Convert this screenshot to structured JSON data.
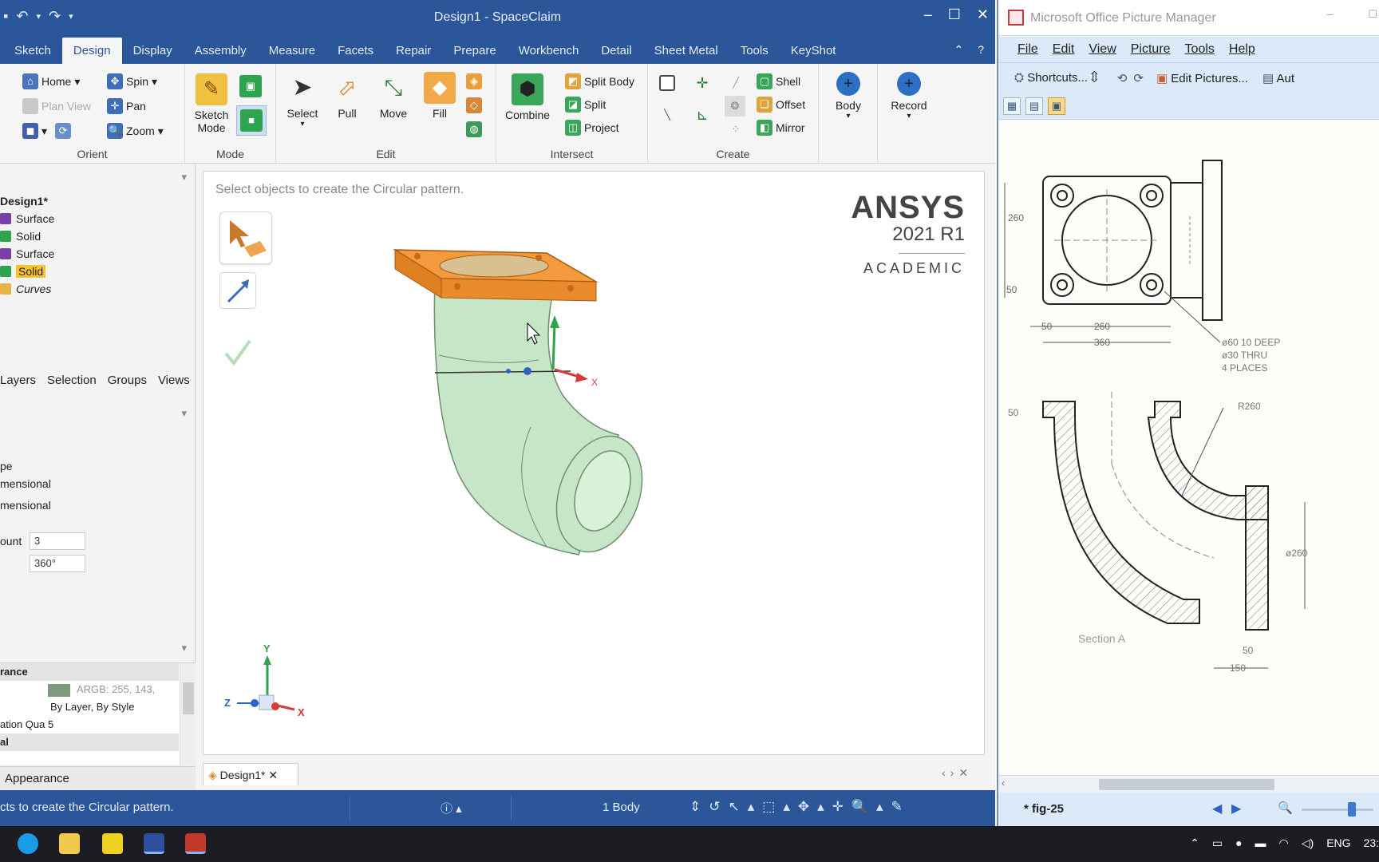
{
  "spaceclaim": {
    "title": "Design1 - SpaceClaim",
    "tabs": [
      "Sketch",
      "Design",
      "Display",
      "Assembly",
      "Measure",
      "Facets",
      "Repair",
      "Prepare",
      "Workbench",
      "Detail",
      "Sheet Metal",
      "Tools",
      "KeyShot"
    ],
    "ribbon": {
      "orient": {
        "label": "Orient",
        "home": "Home",
        "spin": "Spin",
        "plan_view": "Plan View",
        "pan": "Pan",
        "zoom": "Zoom"
      },
      "mode": {
        "label": "Mode",
        "sketch_mode": "Sketch Mode"
      },
      "edit": {
        "label": "Edit",
        "select": "Select",
        "pull": "Pull",
        "move": "Move",
        "fill": "Fill"
      },
      "intersect": {
        "label": "Intersect",
        "combine": "Combine",
        "split_body": "Split Body",
        "split": "Split",
        "project": "Project"
      },
      "create": {
        "label": "Create",
        "shell": "Shell",
        "offset": "Offset",
        "mirror": "Mirror"
      },
      "body": "Body",
      "record": "Record"
    },
    "tree": {
      "root": "Design1*",
      "items": [
        "Surface",
        "Solid",
        "Surface",
        "Solid",
        "Curves"
      ]
    },
    "panel_tabs": [
      "Layers",
      "Selection",
      "Groups",
      "Views"
    ],
    "options": {
      "type": "pe",
      "opt1": "mensional",
      "opt2": "mensional",
      "count_label": "ount",
      "count_value": "3",
      "angle_value": "360°"
    },
    "properties": {
      "header": "rance",
      "color_value": "ARGB: 255, 143,",
      "color_swatch": "#7f9a7f",
      "style": "By Layer, By Style",
      "quality": "ation Qua 5",
      "material": "al"
    },
    "appearance_tab": "Appearance",
    "viewport_hint": "Select objects to create the Circular pattern.",
    "ansys": {
      "brand": "ANSYS",
      "version": "2021 R1",
      "edition": "ACADEMIC"
    },
    "doc_tab": "Design1*",
    "status_text": "cts to create the Circular pattern.",
    "body_count": "1 Body",
    "axes": {
      "x": "X",
      "y": "Y",
      "z": "Z"
    }
  },
  "picture_manager": {
    "title": "Microsoft Office Picture Manager",
    "menu": [
      "File",
      "Edit",
      "View",
      "Picture",
      "Tools",
      "Help"
    ],
    "toolbar": {
      "shortcuts": "Shortcuts...",
      "edit_pictures": "Edit Pictures...",
      "auto": "Aut"
    },
    "drawing": {
      "dims": [
        "260",
        "50",
        "50",
        "260",
        "360",
        "R260",
        "ø260",
        "50",
        "150",
        "50"
      ],
      "note1": "ø60 10 DEEP",
      "note2": "ø30 THRU",
      "note3": "4 PLACES",
      "section": "Section A"
    },
    "file_name": "* fig-25"
  },
  "taskbar": {
    "lang": "ENG",
    "time": "23:"
  }
}
